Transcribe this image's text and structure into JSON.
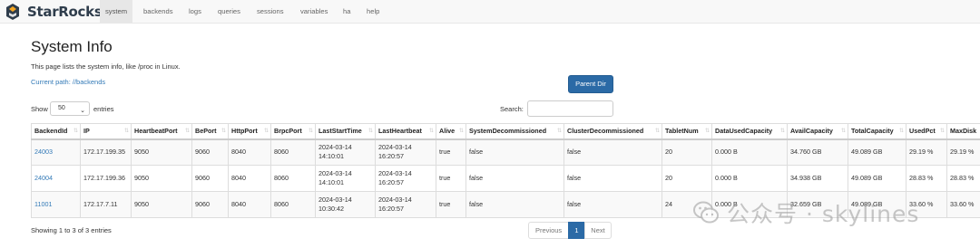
{
  "brand": {
    "name": "StarRocks"
  },
  "nav": {
    "items": [
      {
        "label": "system",
        "active": true
      },
      {
        "label": "backends",
        "active": false
      },
      {
        "label": "logs",
        "active": false
      },
      {
        "label": "queries",
        "active": false
      },
      {
        "label": "sessions",
        "active": false
      },
      {
        "label": "variables",
        "active": false
      },
      {
        "label": "ha",
        "active": false
      },
      {
        "label": "help",
        "active": false
      }
    ]
  },
  "page": {
    "title": "System Info",
    "description": "This page lists the system info, like /proc in Linux.",
    "current_path": "Current path: //backends",
    "parent_button": "Parent Dir"
  },
  "table_controls": {
    "show_label": "Show",
    "page_length": "50",
    "entries_label": "entries",
    "search_label": "Search:",
    "search_value": ""
  },
  "table": {
    "columns": [
      "BackendId",
      "IP",
      "HeartbeatPort",
      "BePort",
      "HttpPort",
      "BrpcPort",
      "LastStartTime",
      "LastHeartbeat",
      "Alive",
      "SystemDecommissioned",
      "ClusterDecommissioned",
      "TabletNum",
      "DataUsedCapacity",
      "AvailCapacity",
      "TotalCapacity",
      "UsedPct",
      "MaxDisk"
    ],
    "rows": [
      [
        "24003",
        "172.17.199.35",
        "9050",
        "9060",
        "8040",
        "8060",
        "2024-03-14 14:10:01",
        "2024-03-14 16:20:57",
        "true",
        "false",
        "false",
        "20",
        "0.000 B",
        "34.760 GB",
        "49.089 GB",
        "29.19 %",
        "29.19 %"
      ],
      [
        "24004",
        "172.17.199.36",
        "9050",
        "9060",
        "8040",
        "8060",
        "2024-03-14 14:10:01",
        "2024-03-14 16:20:57",
        "true",
        "false",
        "false",
        "20",
        "0.000 B",
        "34.938 GB",
        "49.089 GB",
        "28.83 %",
        "28.83 %"
      ],
      [
        "11001",
        "172.17.7.11",
        "9050",
        "9060",
        "8040",
        "8060",
        "2024-03-14 10:30:42",
        "2024-03-14 16:20:57",
        "true",
        "false",
        "false",
        "24",
        "0.000 B",
        "32.659 GB",
        "49.089 GB",
        "33.60 %",
        "33.60 %"
      ]
    ]
  },
  "footer": {
    "info": "Showing 1 to 3 of 3 entries",
    "prev": "Previous",
    "current_page": "1",
    "next": "Next"
  },
  "watermark": {
    "text": "公众号 · skylines"
  }
}
